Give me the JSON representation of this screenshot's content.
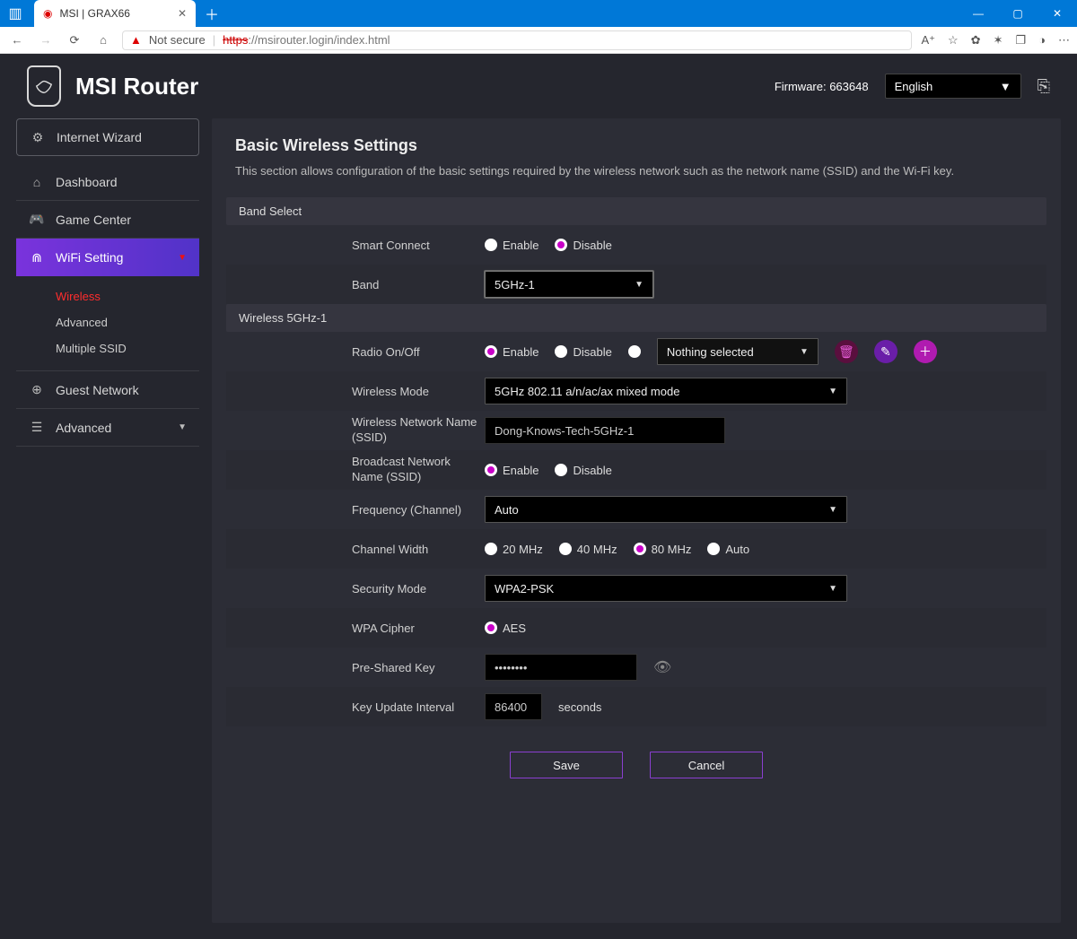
{
  "browser": {
    "tab_title": "MSI | GRAX66",
    "not_secure": "Not secure",
    "url_scheme": "https",
    "url_rest": "://msirouter.login/index.html"
  },
  "header": {
    "brand": "MSI Router",
    "firmware_label": "Firmware: 663648",
    "language": "English"
  },
  "sidebar": {
    "items": [
      {
        "label": "Internet Wizard"
      },
      {
        "label": "Dashboard"
      },
      {
        "label": "Game Center"
      },
      {
        "label": "WiFi Setting"
      },
      {
        "label": "Guest Network"
      },
      {
        "label": "Advanced"
      }
    ],
    "wifi_sub": [
      {
        "label": "Wireless"
      },
      {
        "label": "Advanced"
      },
      {
        "label": "Multiple SSID"
      }
    ]
  },
  "page": {
    "title": "Basic Wireless Settings",
    "desc": "This section allows configuration of the basic settings required by the wireless network such as the network name (SSID) and the Wi-Fi key."
  },
  "band_select": {
    "header": "Band Select",
    "smart_connect_label": "Smart Connect",
    "enable": "Enable",
    "disable": "Disable",
    "band_label": "Band",
    "band_value": "5GHz-1"
  },
  "wireless": {
    "header": "Wireless 5GHz-1",
    "radio_label": "Radio On/Off",
    "enable": "Enable",
    "disable": "Disable",
    "nothing_selected": "Nothing selected",
    "mode_label": "Wireless Mode",
    "mode_value": "5GHz 802.11 a/n/ac/ax mixed mode",
    "ssid_label": "Wireless Network Name (SSID)",
    "ssid_value": "Dong-Knows-Tech-5GHz-1",
    "broadcast_label": "Broadcast Network Name (SSID)",
    "freq_label": "Frequency (Channel)",
    "freq_value": "Auto",
    "chwidth_label": "Channel Width",
    "chw_20": "20 MHz",
    "chw_40": "40 MHz",
    "chw_80": "80 MHz",
    "chw_auto": "Auto",
    "security_label": "Security Mode",
    "security_value": "WPA2-PSK",
    "wpa_cipher_label": "WPA Cipher",
    "wpa_cipher_value": "AES",
    "psk_label": "Pre-Shared Key",
    "psk_value": "••••••••",
    "key_interval_label": "Key Update Interval",
    "key_interval_value": "86400",
    "seconds": "seconds"
  },
  "buttons": {
    "save": "Save",
    "cancel": "Cancel"
  }
}
